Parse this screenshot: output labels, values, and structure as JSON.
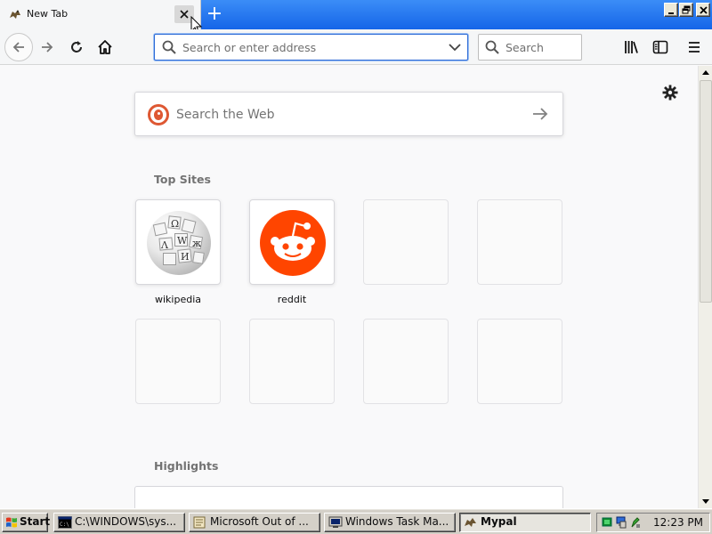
{
  "browser": {
    "tab": {
      "title": "New Tab",
      "favicon": "mypal-icon"
    },
    "new_tab_label": "+",
    "url_bar": {
      "placeholder": "Search or enter address",
      "value": ""
    },
    "search_bar": {
      "placeholder": "Search",
      "value": ""
    }
  },
  "newtab": {
    "web_search": {
      "placeholder": "Search the Web",
      "engine": "duckduckgo-icon"
    },
    "top_sites_title": "Top Sites",
    "top_sites": [
      {
        "label": "wikipedia",
        "icon": "wikipedia-globe-icon"
      },
      {
        "label": "reddit",
        "icon": "reddit-alien-icon"
      },
      {
        "label": ""
      },
      {
        "label": ""
      },
      {
        "label": ""
      },
      {
        "label": ""
      },
      {
        "label": ""
      },
      {
        "label": ""
      }
    ],
    "highlights_title": "Highlights"
  },
  "taskbar": {
    "start_label": "Start",
    "tasks": [
      {
        "label": "C:\\WINDOWS\\sys...",
        "icon": "cmd-icon",
        "active": false
      },
      {
        "label": "Microsoft Out of ...",
        "icon": "outlook-icon",
        "active": false
      },
      {
        "label": "Windows Task Ma...",
        "icon": "task-manager-icon",
        "active": false
      },
      {
        "label": "Mypal",
        "icon": "mypal-icon",
        "active": true
      }
    ],
    "clock": "12:23 PM"
  },
  "colors": {
    "titlebar_blue": "#1565e8",
    "reddit_orange": "#ff4500",
    "duckduckgo_orange": "#de5833",
    "focus_blue": "#2e6bd6"
  }
}
